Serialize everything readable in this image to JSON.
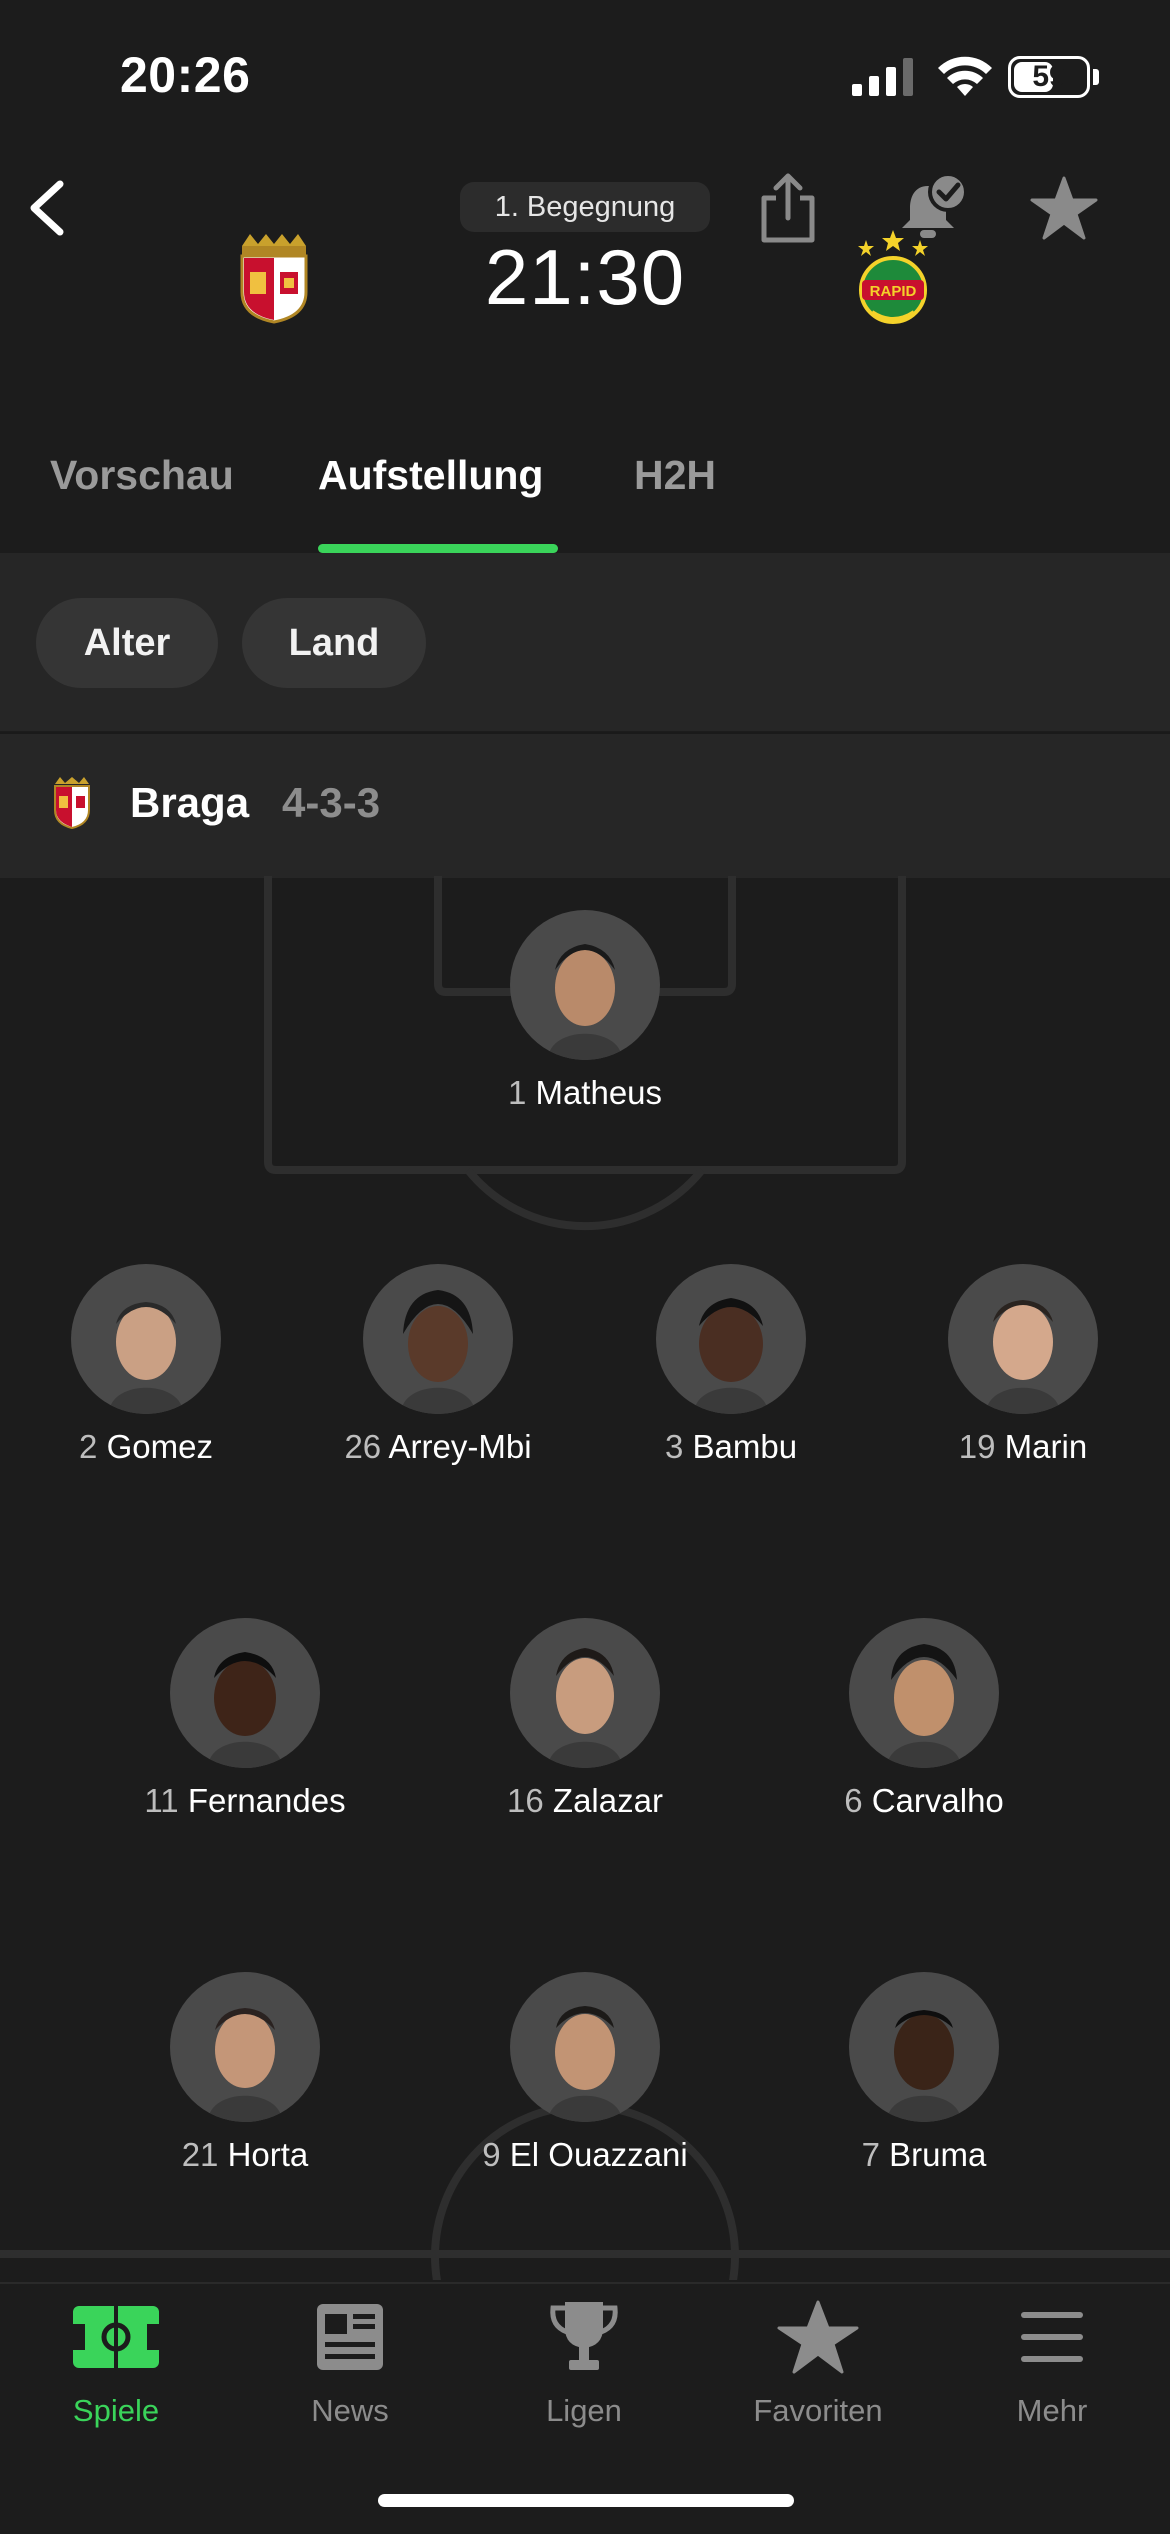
{
  "status_bar": {
    "time": "20:26",
    "battery": "59",
    "battery_level": 0.59
  },
  "header": {
    "round": "1. Begegnung",
    "kickoff": "21:30",
    "home_team": "Braga",
    "away_team": "Rapid"
  },
  "tabs": [
    {
      "label": "Vorschau",
      "active": false
    },
    {
      "label": "Aufstellung",
      "active": true
    },
    {
      "label": "H2H",
      "active": false
    }
  ],
  "filters": [
    "Alter",
    "Land"
  ],
  "lineup": {
    "team": "Braga",
    "formation": "4-3-3",
    "players": [
      {
        "number": "1",
        "name": "Matheus"
      },
      {
        "number": "2",
        "name": "Gomez"
      },
      {
        "number": "26",
        "name": "Arrey-Mbi"
      },
      {
        "number": "3",
        "name": "Bambu"
      },
      {
        "number": "19",
        "name": "Marin"
      },
      {
        "number": "11",
        "name": "Fernandes"
      },
      {
        "number": "16",
        "name": "Zalazar"
      },
      {
        "number": "6",
        "name": "Carvalho"
      },
      {
        "number": "21",
        "name": "Horta"
      },
      {
        "number": "9",
        "name": "El Ouazzani"
      },
      {
        "number": "7",
        "name": "Bruma"
      }
    ]
  },
  "bottom_nav": [
    {
      "label": "Spiele",
      "icon": "pitch-icon",
      "active": true
    },
    {
      "label": "News",
      "icon": "newspaper-icon",
      "active": false
    },
    {
      "label": "Ligen",
      "icon": "trophy-icon",
      "active": false
    },
    {
      "label": "Favoriten",
      "icon": "star-icon",
      "active": false
    },
    {
      "label": "Mehr",
      "icon": "menu-icon",
      "active": false
    }
  ],
  "colors": {
    "accent": "#3ad45a",
    "background": "#1c1c1c",
    "panel": "#262626"
  }
}
